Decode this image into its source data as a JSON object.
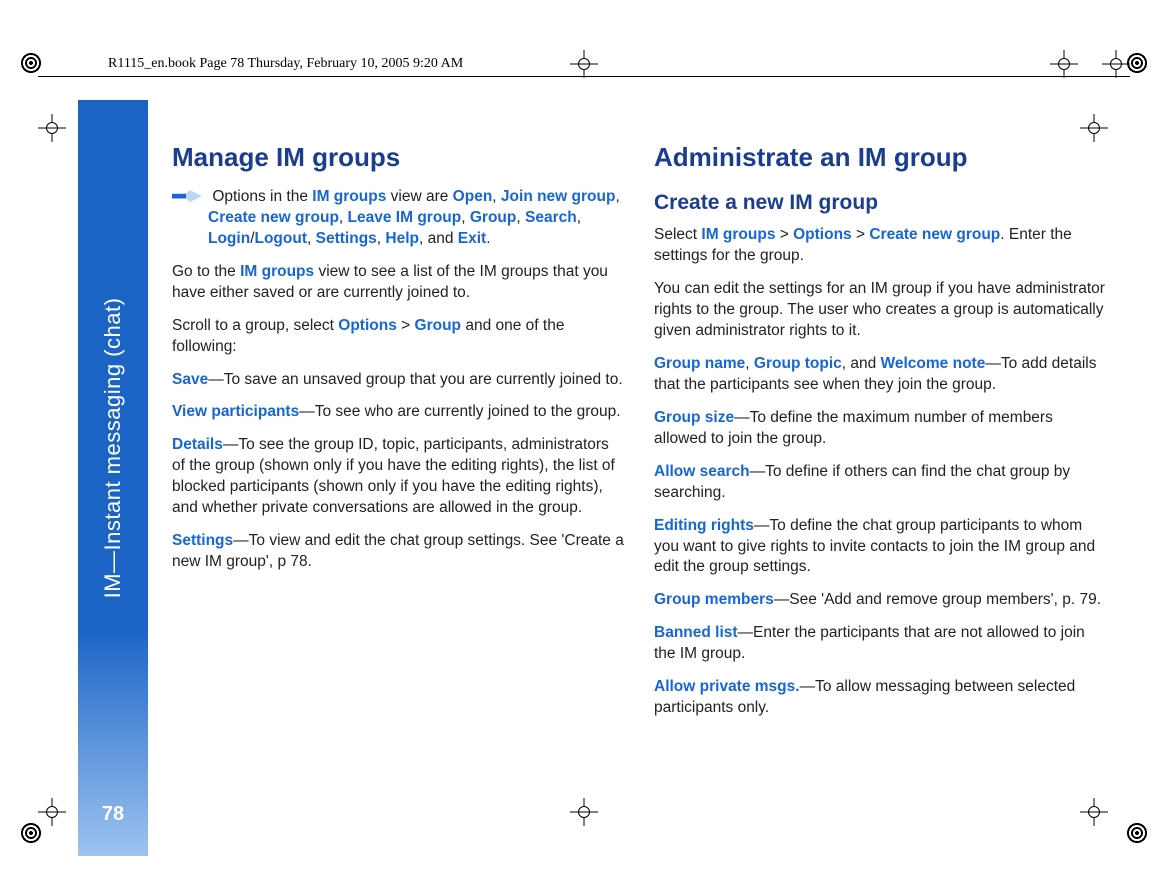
{
  "header": {
    "running": "R1115_en.book  Page 78  Thursday, February 10, 2005  9:20 AM"
  },
  "sidebar": {
    "label": "IM—Instant messaging (chat)",
    "page_number": "78"
  },
  "left": {
    "h2": "Manage IM groups",
    "options_lead": "Options in the ",
    "options_view": "IM groups",
    "options_mid": " view are ",
    "opts": {
      "open": "Open",
      "join": "Join new group",
      "create": "Create new group",
      "leave": "Leave IM group",
      "group": "Group",
      "search": "Search",
      "login": "Login",
      "logout": "Logout",
      "settings": "Settings",
      "help": "Help",
      "exit": "Exit"
    },
    "options_tail": ".",
    "goto_pre": "Go to the ",
    "goto_view": "IM groups",
    "goto_post": " view to see a list of the IM groups that you have either saved or are currently joined to.",
    "scroll_pre": "Scroll to a group, select ",
    "scroll_options": "Options",
    "scroll_gt1": " > ",
    "scroll_group": "Group",
    "scroll_post": " and one of the following:",
    "save_lbl": "Save",
    "save_txt": "—To save an unsaved group that you are currently joined to.",
    "view_lbl": "View participants",
    "view_txt": "—To see who are currently joined to the group.",
    "details_lbl": "Details",
    "details_txt": "—To see the group ID, topic, participants, administrators of the group (shown only if you have the editing rights), the list of blocked participants (shown only if you have the editing rights), and whether private conversations are allowed in the group.",
    "settings_lbl": "Settings",
    "settings_txt": "—To view and edit the chat group settings. See 'Create a new IM group', p 78."
  },
  "right": {
    "h2": "Administrate an IM group",
    "h3": "Create a new IM group",
    "sel_pre": "Select ",
    "sel_im": "IM groups",
    "sel_gt1": " > ",
    "sel_opt": "Options",
    "sel_gt2": " > ",
    "sel_create": "Create new group",
    "sel_post": ". Enter the settings for the group.",
    "edit_para": "You can edit the settings for an IM group if you have administrator rights to the group. The user who creates a group is automatically given administrator rights to it.",
    "gname": "Group name",
    "comma1": ", ",
    "gtopic": "Group topic",
    "and": ", and ",
    "wnote": "Welcome note",
    "gntw_txt": "—To add details that the participants see when they join the group.",
    "gsize_lbl": "Group size",
    "gsize_txt": "—To define the maximum number of members allowed to join the group.",
    "asrch_lbl": "Allow search",
    "asrch_txt": "—To define if others can find the chat group by searching.",
    "edit_lbl": "Editing rights",
    "edit_txt": "—To define the chat group participants to whom you want to give rights to invite contacts to join the IM group and edit the group settings.",
    "gmem_lbl": "Group members",
    "gmem_txt": "—See 'Add and remove group members', p. 79.",
    "ban_lbl": "Banned list",
    "ban_txt": "—Enter the participants that are not allowed to join the IM group.",
    "apm_lbl": "Allow private msgs.",
    "apm_txt": "—To allow messaging between selected participants only."
  }
}
